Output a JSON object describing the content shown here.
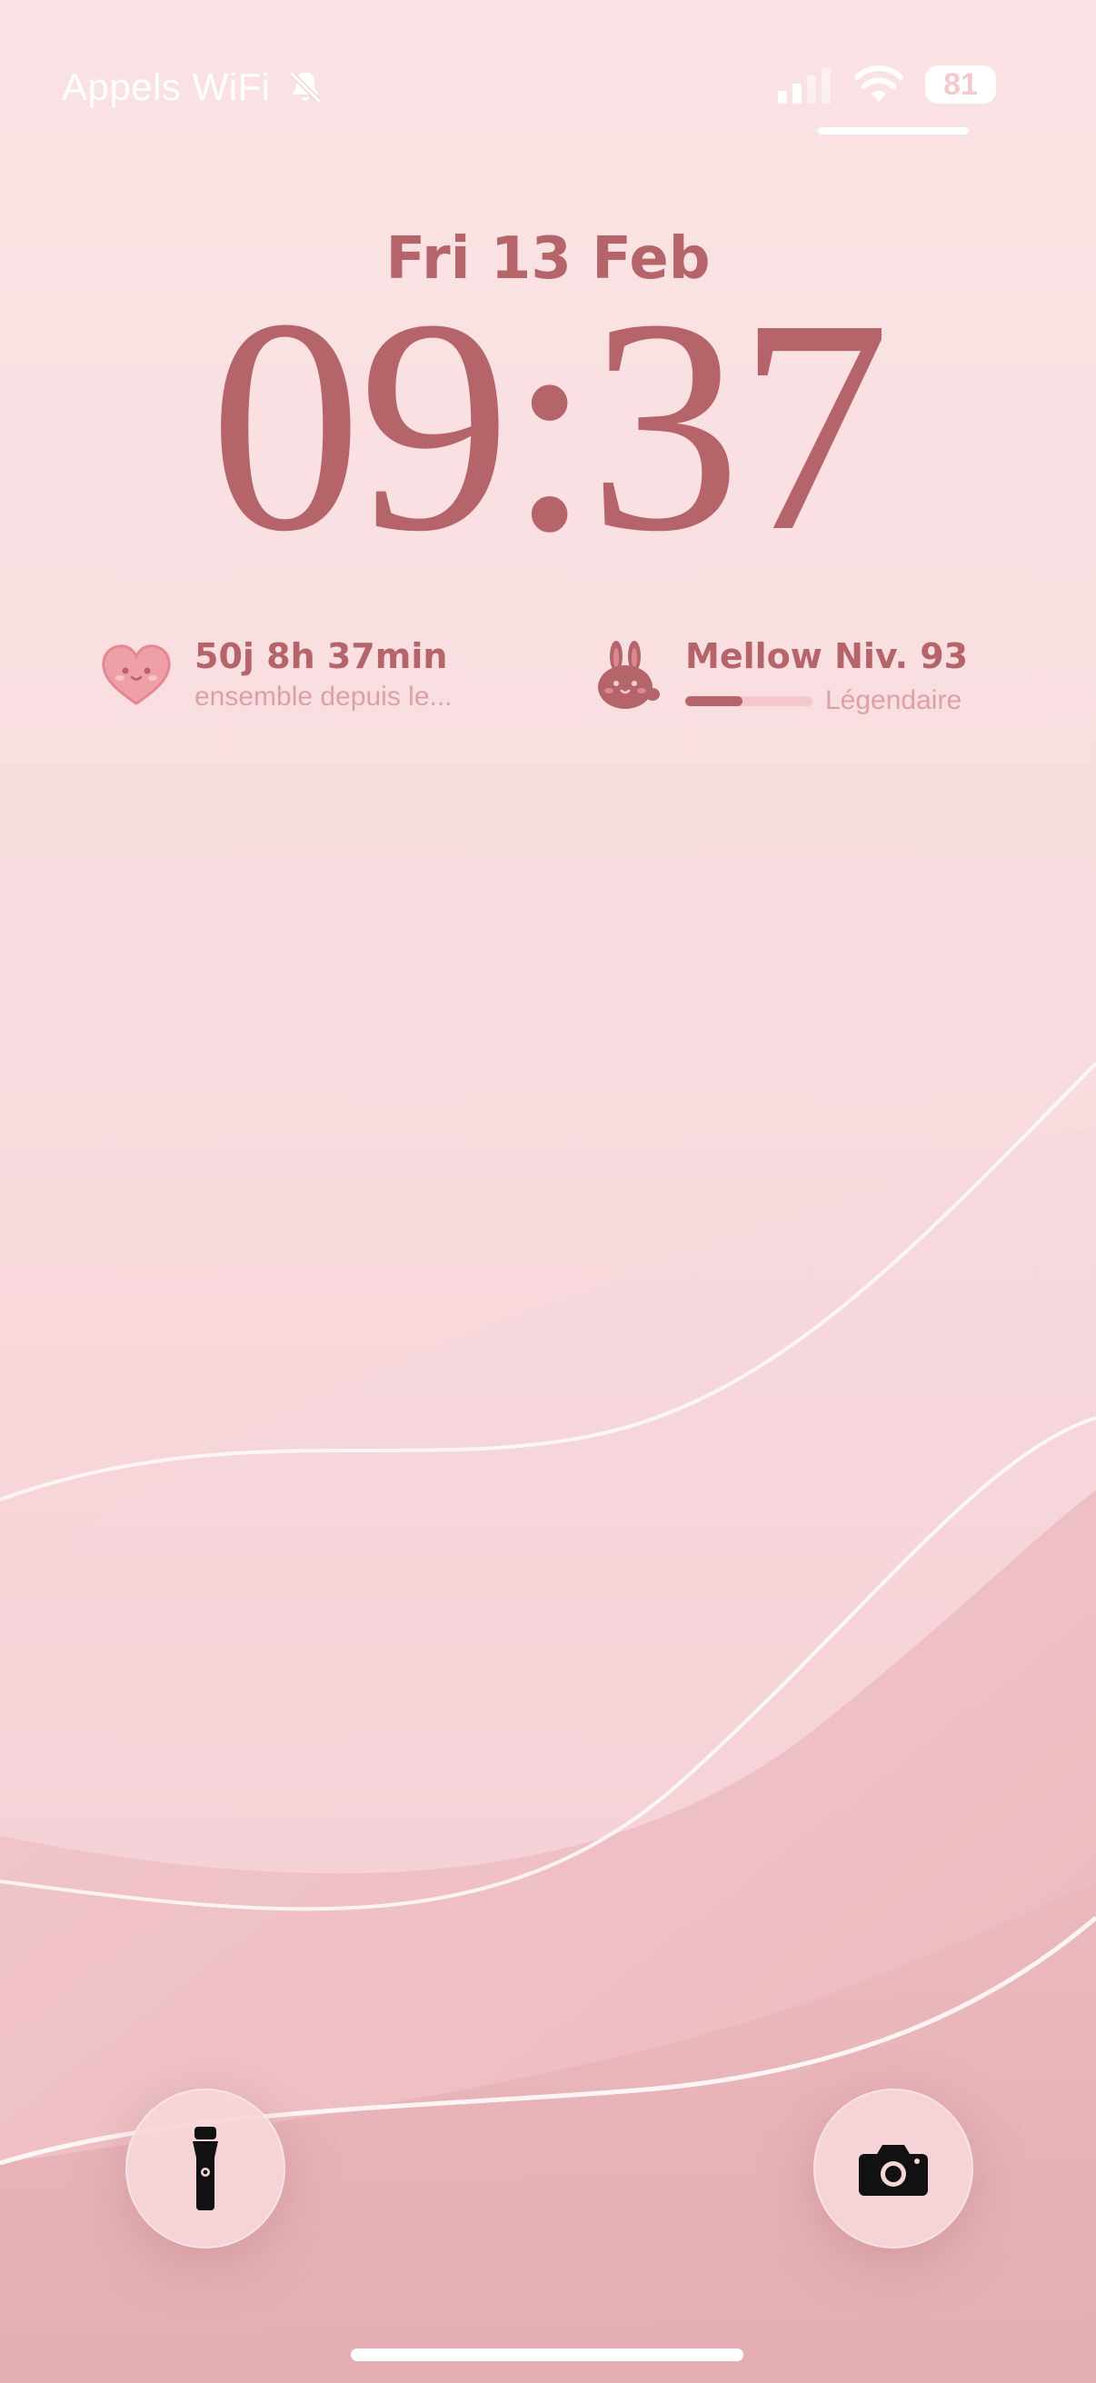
{
  "status_bar": {
    "carrier_text": "Appels WiFi",
    "silent_icon": "bell-slash-icon",
    "signal_icon": "cellular-signal-icon",
    "wifi_icon": "wifi-icon",
    "battery_level": "81"
  },
  "lock_screen": {
    "date": "Fri 13 Feb",
    "time": "09:37"
  },
  "widgets": {
    "relationship": {
      "icon": "heart-face-icon",
      "title": "50j 8h 37min",
      "subtitle": "ensemble depuis le..."
    },
    "pet": {
      "icon": "bunny-icon",
      "title": "Mellow Niv. 93",
      "progress": 0.45,
      "rank": "Légendaire"
    }
  },
  "quick_actions": {
    "flashlight_icon": "flashlight-icon",
    "camera_icon": "camera-icon"
  },
  "colors": {
    "accent": "#b5646a",
    "muted": "#dba1a6",
    "background": "#f9dfe1"
  }
}
